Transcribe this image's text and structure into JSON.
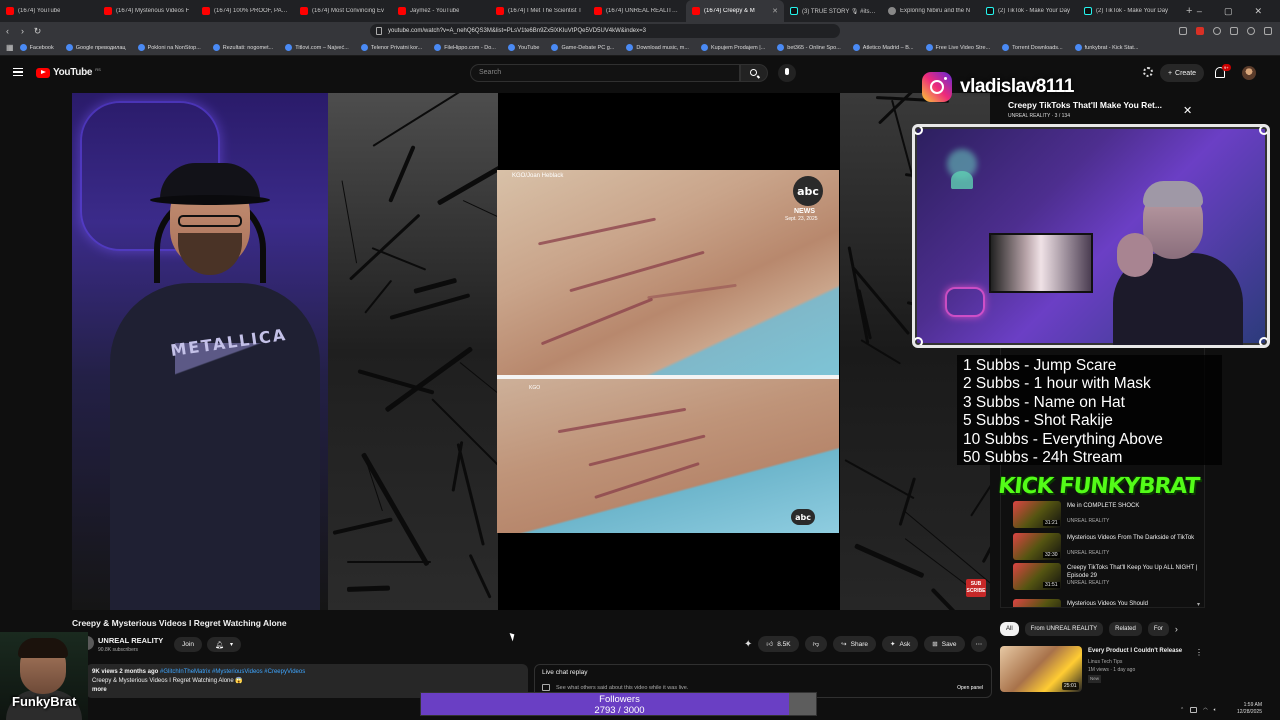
{
  "browser": {
    "tabs": [
      {
        "label": "(1674) YouTube",
        "icon": "youtube"
      },
      {
        "label": "(1674) Mysterious Videos F",
        "icon": "youtube"
      },
      {
        "label": "(1674) 100% PROOF, PARA",
        "icon": "youtube"
      },
      {
        "label": "(1674) Most Convincing Ev",
        "icon": "youtube"
      },
      {
        "label": "Jaymez - YouTube",
        "icon": "youtube"
      },
      {
        "label": "(1674) I Met The Scientist T",
        "icon": "youtube"
      },
      {
        "label": "(1674) UNREAL REALITY - Y",
        "icon": "youtube"
      },
      {
        "label": "(1674) Creepy & M",
        "icon": "youtube",
        "active": true
      },
      {
        "label": "(3) TRUE STORY 🎙 #itsnot",
        "icon": "tiktok"
      },
      {
        "label": "Exploring Nibiru and the N",
        "icon": "generic"
      },
      {
        "label": "(2) TikTok - Make Your Day",
        "icon": "tiktok"
      },
      {
        "label": "(2) TikTok - Make Your Day",
        "icon": "tiktok"
      }
    ],
    "new_tab": "+",
    "url": "youtube.com/watch?v=A_nehQ6QS3M&list=PLsV1te6Bn9Zx5lXKIuVtPQe5VD5UV4kW&index=3",
    "bookmarks": [
      "Facebook",
      "Google преводилац",
      "Pokloni na NonStop...",
      "Rezultati: nogomet...",
      "Titlovi.com – Najveć...",
      "Telenor Privatni kor...",
      "FileHippo.com - Do...",
      "YouTube",
      "Game-Debate PC g...",
      "Download music, m...",
      "Kupujem Prodajem |...",
      "bet365 - Online Spo...",
      "Atletico Madrid – B...",
      "Free Live Video Stre...",
      "Torrent Downloads...",
      "funkybrat - Kick Stat..."
    ]
  },
  "masthead": {
    "logo_text": "YouTube",
    "logo_sup": "RS",
    "search_placeholder": "Search",
    "create_label": "Create",
    "notif_count": "9+"
  },
  "video": {
    "clip_credit": "KGO/Joan Heblack",
    "network": "abc",
    "network_sub": "NEWS",
    "air_date": "Sept. 23, 2025",
    "clip2_credit": "KGO",
    "shirt_text": "METALLICA",
    "sub_badge": "SUB SCRIBE"
  },
  "meta": {
    "title": "Creepy & Mysterious Videos I Regret Watching Alone",
    "channel": "UNREAL REALITY",
    "subscribers": "90.8K subscribers",
    "join_label": "Join",
    "likes": "8.5K",
    "share_label": "Share",
    "ask_label": "Ask",
    "save_label": "Save",
    "views": "9K views  2 months ago",
    "tags": "#GlitchInTheMatrix #MysteriousVideos #CreepyVideos",
    "desc_line": "Creepy & Mysterious Videos I Regret Watching Alone 😱",
    "more_label": "more"
  },
  "live_chat": {
    "title": "Live chat replay",
    "subtitle": "See what others said about this video while it was live.",
    "open_panel": "Open panel"
  },
  "sidebar": {
    "chips": [
      "All",
      "From UNREAL REALITY",
      "Related",
      "For"
    ],
    "playlist": [
      {
        "title": "Me in COMPLETE SHOCK",
        "channel": "UNREAL REALITY",
        "duration": "31:21"
      },
      {
        "title": "Mysterious Videos From The Darkside of TikTok",
        "channel": "UNREAL REALITY",
        "duration": "32:30"
      },
      {
        "title": "Creepy TikToks That'll Keep You Up ALL NIGHT | Episode 29",
        "channel": "UNREAL REALITY",
        "duration": "31:51"
      },
      {
        "title": "Mysterious Videos You Should",
        "channel": "",
        "duration": ""
      }
    ],
    "rec": {
      "title": "Every Product I Couldn't Release",
      "channel": "Linus Tech Tips",
      "meta": "1M views · 1 day ago",
      "badge": "New",
      "duration": "25:01"
    }
  },
  "overlay": {
    "instagram_handle": "vladislav8111",
    "miniplayer_title": "Creepy TikToks That'll Make You Ret...",
    "miniplayer_sub": "UNREAL REALITY · 3 / 134",
    "goals": [
      "1 Subbs - Jump Scare",
      "2 Subbs - 1 hour with Mask",
      "3 Subbs - Name on Hat",
      "5 Subbs - Shot Rakije",
      "10 Subbs - Everything Above",
      "50 Subbs - 24h Stream"
    ],
    "kick_brand": "KICK FUNKYBRAT",
    "streamer_name": "FunkyBrat",
    "followers_label": "Followers",
    "followers_count": "2793 / 3000",
    "followers_progress": 0.931
  },
  "system": {
    "time": "1:59 AM",
    "date": "12/28/2025"
  },
  "colors": {
    "youtube_red": "#ff0000",
    "kick_green": "#53fc18",
    "followers_purple": "#6a3fc4"
  }
}
